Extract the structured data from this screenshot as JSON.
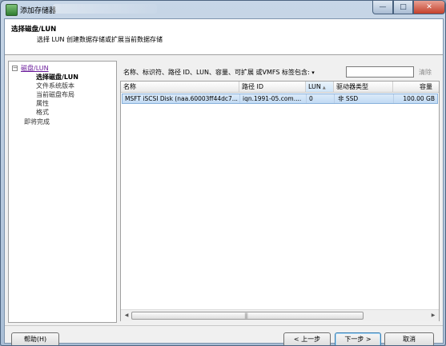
{
  "window": {
    "title": "添加存储器"
  },
  "header": {
    "title": "选择磁盘/LUN",
    "subtitle": "选择 LUN 创建数据存储或扩展当前数据存储"
  },
  "nav": {
    "toggle": "−",
    "items": [
      {
        "label": "磁盘/LUN"
      },
      {
        "label": "选择磁盘/LUN"
      },
      {
        "label": "文件系统版本"
      },
      {
        "label": "当前磁盘布局"
      },
      {
        "label": "属性"
      },
      {
        "label": "格式"
      },
      {
        "label": "即将完成"
      }
    ]
  },
  "filter": {
    "label": "名称、标识符、路径 ID、LUN、容量、可扩展 或VMFS 标签包含:",
    "dropdown_arrow": "▾",
    "value": "",
    "clear_label": "清除"
  },
  "table": {
    "columns": [
      "名称",
      "路径 ID",
      "LUN",
      "驱动器类型",
      "容量"
    ],
    "sort_icon": "▲",
    "rows": [
      [
        "MSFT iSCSI Disk (naa.60003ff44dc7...",
        "iqn.1991-05.com....",
        "0",
        "非 SSD",
        "100.00 GB"
      ]
    ]
  },
  "scrollbar": {
    "left_arrow": "◀",
    "right_arrow": "▶",
    "grip": "|||"
  },
  "buttons": {
    "help": "帮助(H)",
    "back": "< 上一步",
    "next": "下一步 >",
    "cancel": "取消"
  },
  "titlebar_buttons": {
    "minimize": "—",
    "maximize": "□",
    "close": "✕"
  }
}
